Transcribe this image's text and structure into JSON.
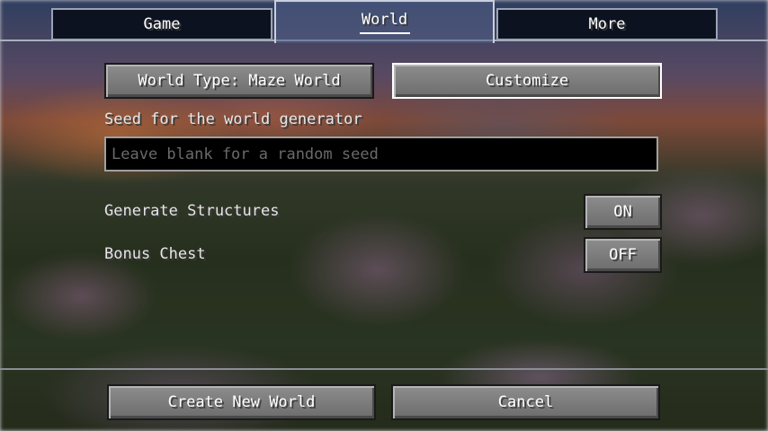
{
  "tabs": [
    {
      "label": "Game"
    },
    {
      "label": "World"
    },
    {
      "label": "More"
    }
  ],
  "world": {
    "world_type_label": "World Type: Maze World",
    "customize_label": "Customize",
    "seed_label": "Seed for the world generator",
    "seed_value": "",
    "seed_placeholder": "Leave blank for a random seed",
    "generate_structures_label": "Generate Structures",
    "generate_structures_value": "ON",
    "bonus_chest_label": "Bonus Chest",
    "bonus_chest_value": "OFF"
  },
  "footer": {
    "create_label": "Create New World",
    "cancel_label": "Cancel"
  }
}
